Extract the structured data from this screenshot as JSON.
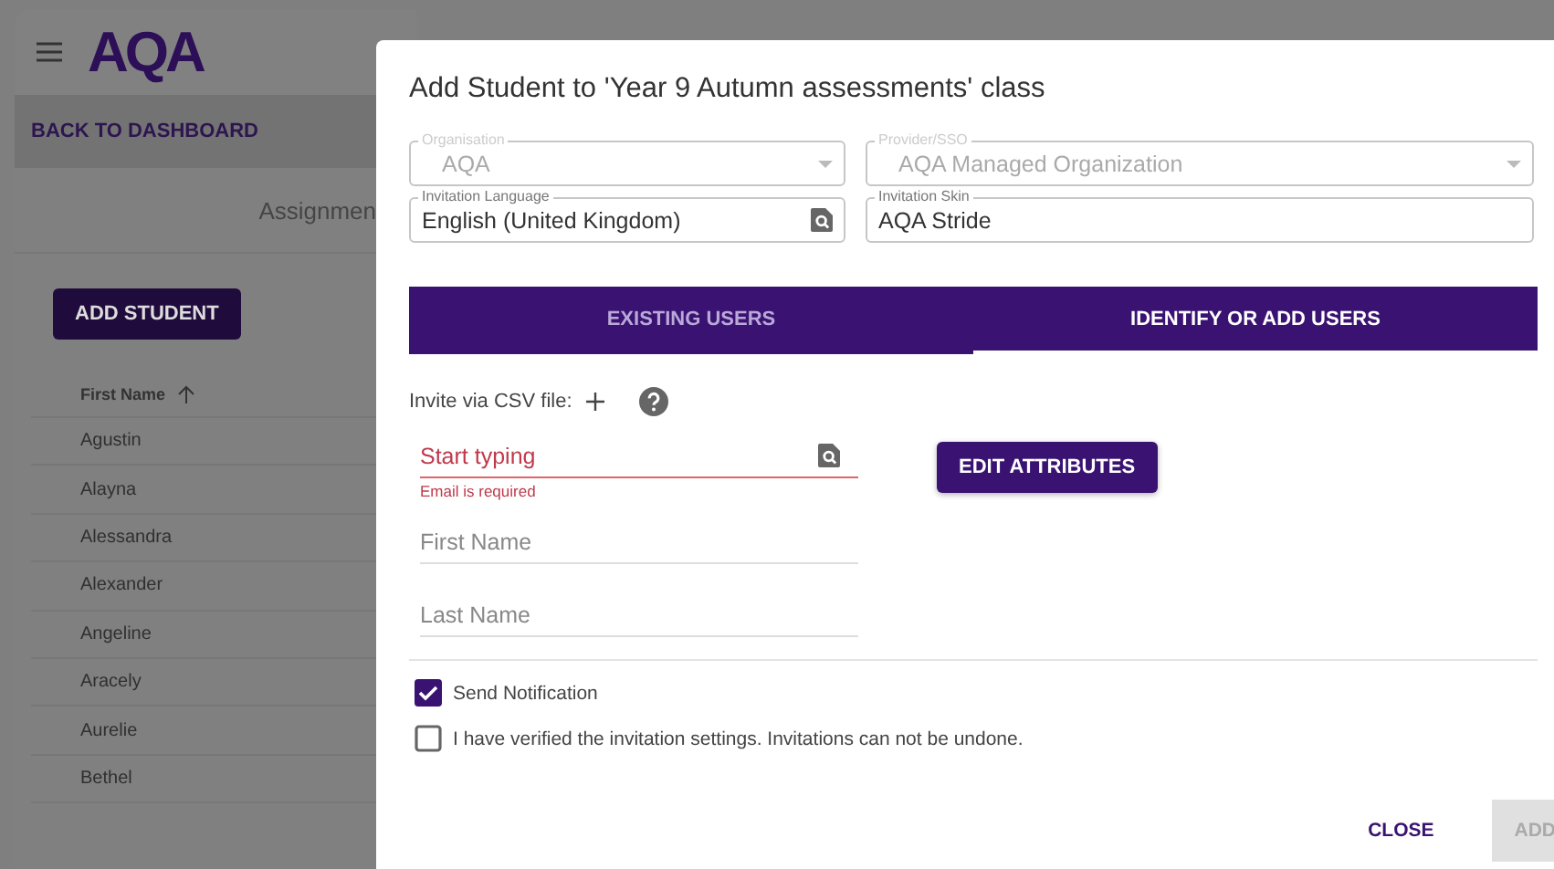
{
  "app": {
    "logo": "AQA",
    "back_link": "BACK TO DASHBOARD",
    "section_tab": "Assignmen",
    "add_button": "ADD STUDENT",
    "table": {
      "columns": [
        {
          "label": "First Name",
          "sorted": true
        }
      ],
      "rows": [
        "Agustin",
        "Alayna",
        "Alessandra",
        "Alexander",
        "Angeline",
        "Aracely",
        "Aurelie",
        "Bethel"
      ]
    }
  },
  "dialog": {
    "title": "Add Student to 'Year 9 Autumn assessments' class",
    "selects": [
      {
        "label": "Organisation",
        "value": "AQA",
        "disabled": true
      },
      {
        "label": "Provider/SSO",
        "value": "AQA Managed Organization",
        "disabled": true
      }
    ],
    "lookups": [
      {
        "label": "Invitation Language",
        "value": "English (United Kingdom)",
        "search": true
      },
      {
        "label": "Invitation Skin",
        "value": "AQA Stride",
        "search": false
      }
    ],
    "tabs": [
      {
        "label": "EXISTING USERS",
        "selected": false
      },
      {
        "label": "IDENTIFY OR ADD USERS",
        "selected": true
      }
    ],
    "csv": {
      "label": "Invite via CSV file:"
    },
    "email": {
      "placeholder": "Start typing",
      "error": "Email is required"
    },
    "name_fields": [
      {
        "placeholder": "First Name"
      },
      {
        "placeholder": "Last Name"
      }
    ],
    "edit_button": "EDIT ATTRIBUTES",
    "checkboxes": [
      {
        "label": "Send Notification",
        "checked": true
      },
      {
        "label": "I have verified the invitation settings. Invitations can not be undone.",
        "checked": false
      }
    ],
    "buttons": [
      {
        "label": "CLOSE",
        "disabled": false
      },
      {
        "label": "ADD",
        "disabled": true
      }
    ]
  }
}
